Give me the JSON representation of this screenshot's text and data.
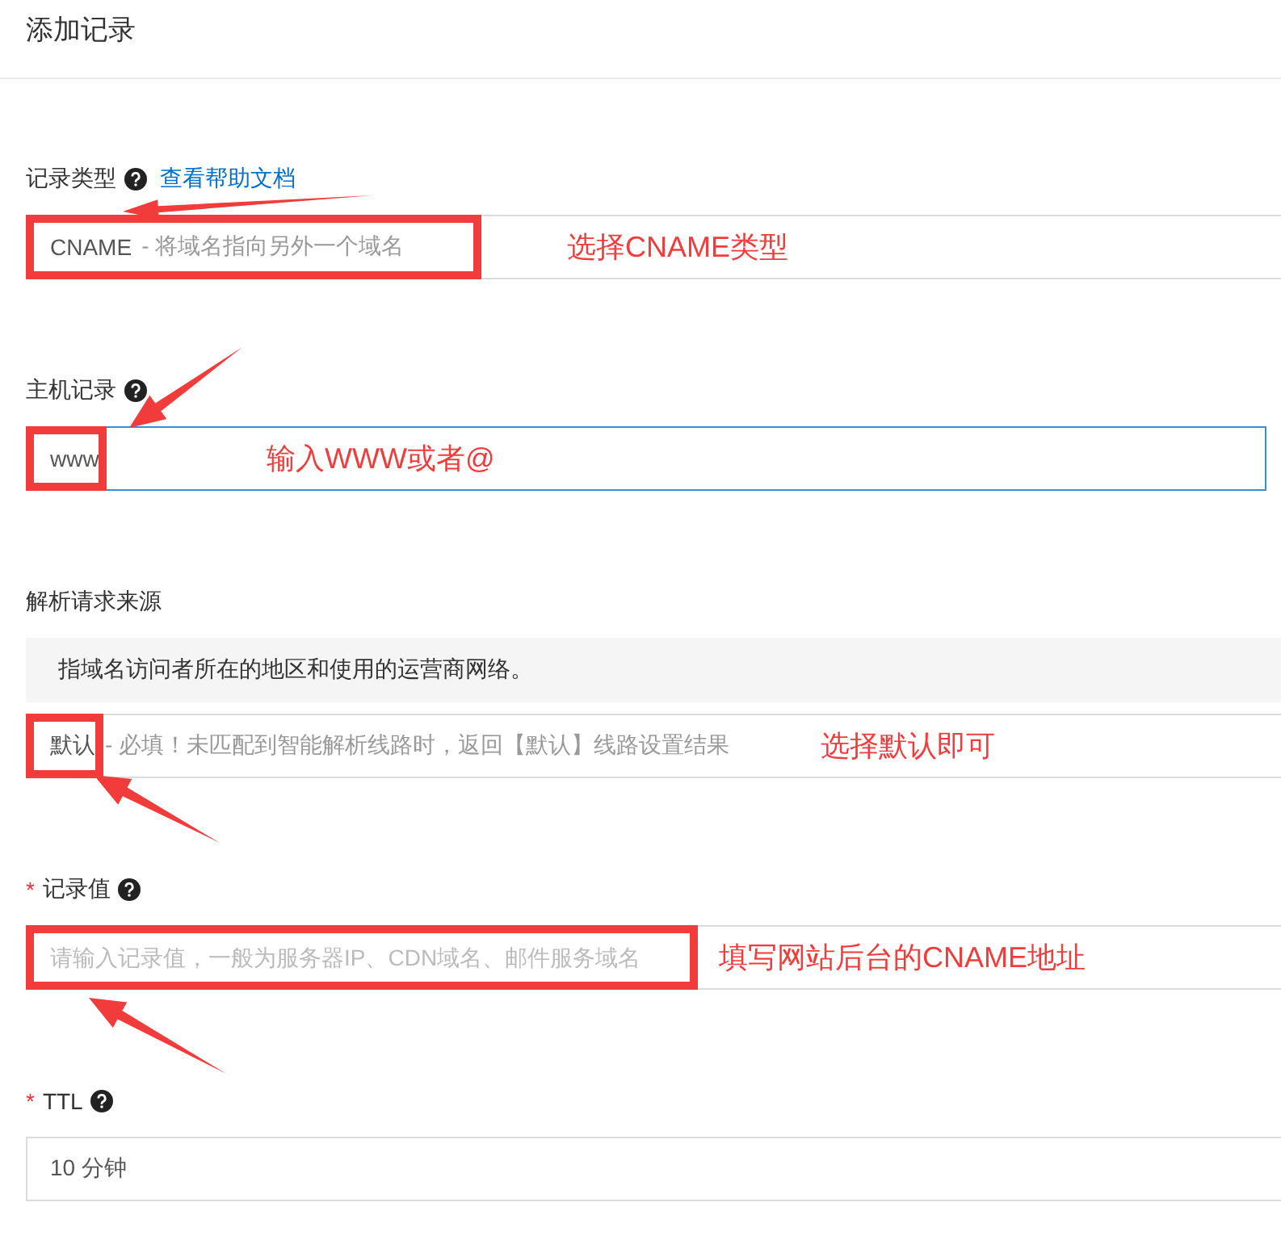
{
  "title": "添加记录",
  "required_mark": "*",
  "fields": [
    {
      "label": "记录类型",
      "required": false,
      "help": true,
      "link": "查看帮助文档",
      "kind": "select",
      "value": "CNAME",
      "description": "- 将域名指向另外一个域名",
      "focused": false,
      "annotation": {
        "text": "选择CNAME类型"
      }
    },
    {
      "label": "主机记录",
      "required": false,
      "help": true,
      "kind": "input",
      "value": "www",
      "focused": true,
      "annotation": {
        "text": "输入WWW或者@"
      }
    },
    {
      "label": "解析请求来源",
      "required": false,
      "help": false,
      "info": "指域名访问者所在的地区和使用的运营商网络。",
      "kind": "select",
      "value": "默认",
      "description": "- 必填！未匹配到智能解析线路时，返回【默认】线路设置结果",
      "focused": false,
      "annotation": {
        "text": "选择默认即可"
      }
    },
    {
      "label": "记录值",
      "required": true,
      "help": true,
      "kind": "input",
      "placeholder": "请输入记录值，一般为服务器IP、CDN域名、邮件服务域名",
      "focused": false,
      "annotation": {
        "text": "填写网站后台的CNAME地址"
      }
    },
    {
      "label": "TTL",
      "required": true,
      "help": true,
      "kind": "select",
      "value": "10 分钟",
      "focused": false
    }
  ]
}
